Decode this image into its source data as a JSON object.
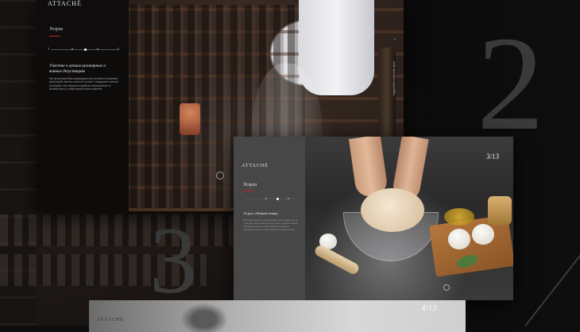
{
  "brand": {
    "logo_text": "ATTACHÉ"
  },
  "slide2": {
    "menu_title": "Услуги",
    "heading": "Участие в лучших кулинарных и винных дегустациях",
    "body": "Мы предложим Вам индивидуальные условия посещения дегустаций, мастер-классов и встреч с ведущими сомелье и шефами. Мы поможем подобрать мероприятие по Вашему вкусу и забронируем места заранее.",
    "side_label": "подробнее о винной карте",
    "big_number": "2"
  },
  "slide3": {
    "counter": "3/13",
    "menu_title": "Услуги",
    "heading": "Услуги «Личный повар»",
    "body": "Если вы желаете организовать ужин дома или за городом, наши повара приготовят для вас блюда любой кухни мира. Мы подберём шефа и составим меню с учетом Ваших предпочтений.",
    "big_number": "3"
  },
  "slide4": {
    "counter": "4/13",
    "logo_text": "ATTACHÉ"
  }
}
